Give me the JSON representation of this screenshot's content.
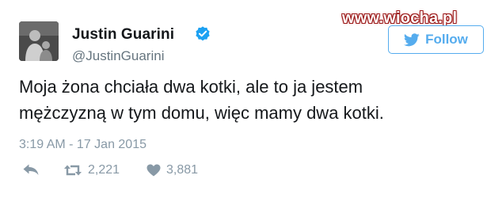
{
  "watermark": "www.wiocha.pl",
  "author": {
    "name": "Justin Guarini",
    "handle": "@JustinGuarini",
    "verified": true
  },
  "follow_button": {
    "label": "Follow",
    "icon": "bird-icon"
  },
  "tweet": {
    "text_lines": [
      "Moja żona chciała dwa kotki, ale to ja jestem",
      "mężczyzną w tym domu, więc mamy dwa kotki."
    ],
    "timestamp": "3:19 AM - 17 Jan 2015"
  },
  "actions": {
    "reply": {
      "icon": "reply-icon"
    },
    "retweet": {
      "icon": "retweet-icon",
      "count": "2,221"
    },
    "like": {
      "icon": "heart-icon",
      "count": "3,881"
    }
  },
  "colors": {
    "accent": "#55acee",
    "verified": "#1da1f2",
    "muted": "#8899a6",
    "text": "#14171a",
    "watermark_outline": "#9a1a1a"
  }
}
